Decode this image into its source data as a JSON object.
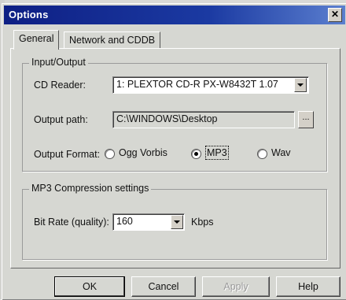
{
  "window": {
    "title": "Options",
    "close_glyph": "✕"
  },
  "tabs": [
    {
      "label": "General",
      "active": true
    },
    {
      "label": "Network and CDDB",
      "active": false
    }
  ],
  "input_output": {
    "group_label": "Input/Output",
    "cd_reader_label": "CD Reader:",
    "cd_reader_value": "1: PLEXTOR  CD-R   PX-W8432T 1.07",
    "output_path_label": "Output path:",
    "output_path_value": "C:\\WINDOWS\\Desktop",
    "browse_label": "...",
    "output_format_label": "Output Format:",
    "formats": [
      {
        "label": "Ogg Vorbis",
        "checked": false
      },
      {
        "label": "MP3",
        "checked": true
      },
      {
        "label": "Wav",
        "checked": false
      }
    ]
  },
  "compression": {
    "group_label": "MP3 Compression settings",
    "bitrate_label": "Bit Rate (quality):",
    "bitrate_value": "160",
    "bitrate_unit": "Kbps"
  },
  "buttons": {
    "ok": "OK",
    "cancel": "Cancel",
    "apply": "Apply",
    "help": "Help"
  },
  "colors": {
    "title_bar": "#0e1f84",
    "dialog_face": "#d6d7d2"
  }
}
